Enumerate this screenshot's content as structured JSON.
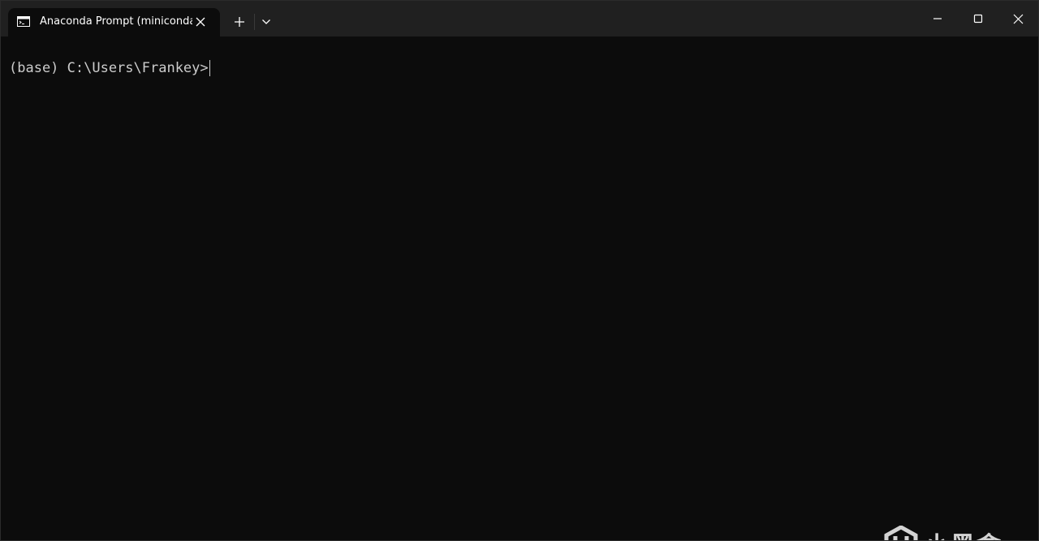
{
  "window": {
    "tab_title": "Anaconda Prompt (miniconda",
    "tab_icon": "terminal-icon",
    "new_tab_icon": "plus-icon",
    "dropdown_icon": "chevron-down-icon",
    "minimize_icon": "minimize-icon",
    "maximize_icon": "maximize-icon",
    "close_icon": "close-icon"
  },
  "console": {
    "prompt": "(base) C:\\Users\\Frankey>",
    "text_color": "#cccccc",
    "background": "#0c0c0c"
  },
  "watermark": {
    "logo": "heybox-logo",
    "text": "小黑盒"
  }
}
